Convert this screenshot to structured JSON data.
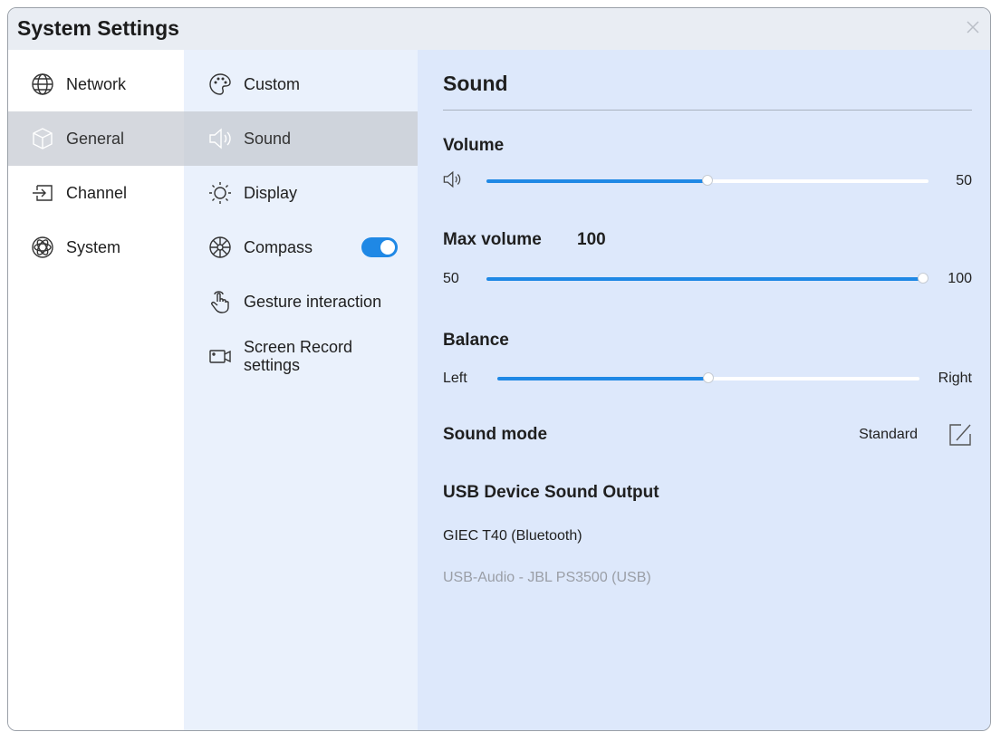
{
  "window": {
    "title": "System Settings"
  },
  "nav": [
    {
      "label": "Network",
      "icon": "globe-icon"
    },
    {
      "label": "General",
      "icon": "cube-icon",
      "selected": true
    },
    {
      "label": "Channel",
      "icon": "input-arrow-icon"
    },
    {
      "label": "System",
      "icon": "atom-icon"
    }
  ],
  "subnav": [
    {
      "label": "Custom",
      "icon": "palette-icon"
    },
    {
      "label": "Sound",
      "icon": "speaker-icon",
      "selected": true
    },
    {
      "label": "Display",
      "icon": "sun-icon"
    },
    {
      "label": "Compass",
      "icon": "compass-icon",
      "toggle": true
    },
    {
      "label": "Gesture interaction",
      "icon": "hand-pointer-icon"
    },
    {
      "label_line1": "Screen Record",
      "label_line2": "settings",
      "icon": "camera-icon"
    }
  ],
  "sound": {
    "title": "Sound",
    "volume": {
      "label": "Volume",
      "value": "50",
      "fraction": 0.5
    },
    "max_volume": {
      "label": "Max volume",
      "value": "100",
      "min": "50",
      "max": "100",
      "fraction": 1.0
    },
    "balance": {
      "label": "Balance",
      "left": "Left",
      "right": "Right",
      "fraction": 0.5
    },
    "sound_mode": {
      "label": "Sound mode",
      "value": "Standard"
    },
    "usb_output": {
      "label": "USB Device Sound Output",
      "devices": [
        {
          "name": "GIEC T40 (Bluetooth)",
          "active": true
        },
        {
          "name": "USB-Audio - JBL PS3500 (USB)",
          "active": false
        }
      ]
    }
  },
  "colors": {
    "accent": "#1f88e5",
    "pane": "#dde8fb",
    "subnav": "#eaf1fc"
  }
}
